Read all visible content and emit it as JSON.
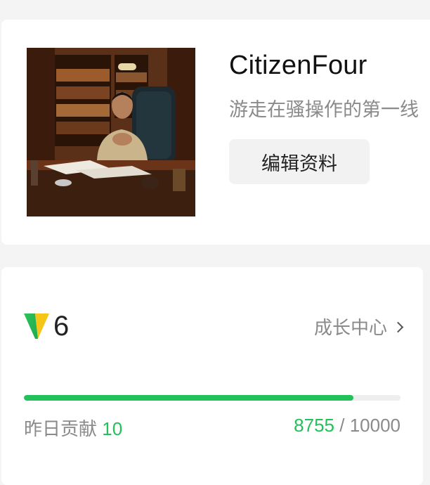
{
  "profile": {
    "username": "CitizenFour",
    "bio": "游走在骚操作的第一线",
    "edit_label": "编辑资料"
  },
  "level": {
    "value": "6",
    "growth_center_label": "成长中心",
    "progress_fraction": 0.8755,
    "yesterday_label": "昨日贡献",
    "yesterday_value": "10",
    "current_score": "8755",
    "separator": " / ",
    "target_score": "10000",
    "accent_color": "#23c15a"
  }
}
